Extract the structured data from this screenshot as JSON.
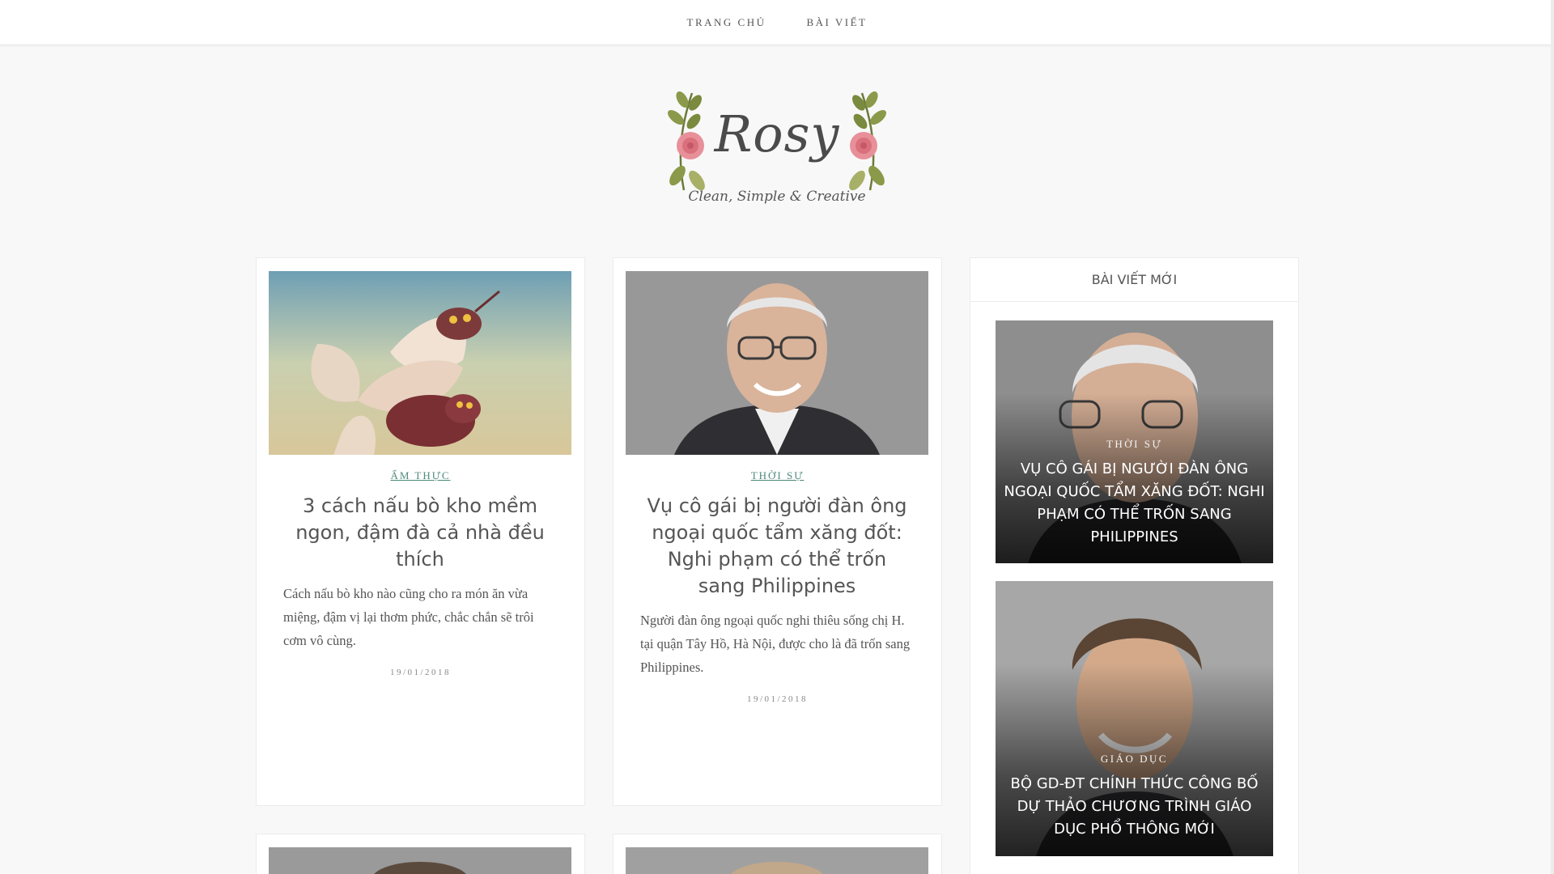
{
  "nav": {
    "items": [
      "TRANG CHỦ",
      "BÀI VIẾT"
    ]
  },
  "logo": {
    "title": "Rosy",
    "tagline": "Clean, Simple & Creative"
  },
  "posts": [
    {
      "category": "ẨM THỰC",
      "title": "3 cách nấu bò kho mềm ngon, đậm đà cả nhà đều thích",
      "excerpt": "Cách nấu bò kho nào cũng cho ra món ăn vừa miệng, đậm vị lại thơm phức, chắc chắn sẽ trôi cơm vô cùng.",
      "date": "19/01/2018",
      "image": "fantasy-bird-creature-illustration"
    },
    {
      "category": "THỜI SỰ",
      "title": "Vụ cô gái bị người đàn ông ngoại quốc tẩm xăng đốt: Nghi phạm có thể trốn sang Philippines",
      "excerpt": "Người đàn ông ngoại quốc nghi thiêu sống chị H. tại quận Tây Hồ, Hà Nội, được cho là đã trốn sang Philippines.",
      "date": "19/01/2018",
      "image": "elderly-man-portrait"
    }
  ],
  "sidebar": {
    "title": "BÀI VIẾT MỚI",
    "items": [
      {
        "category": "THỜI SỰ",
        "title": "VỤ CÔ GÁI BỊ NGƯỜI ĐÀN ÔNG NGOẠI QUỐC TẨM XĂNG ĐỐT: NGHI PHẠM CÓ THỂ TRỐN SANG PHILIPPINES",
        "image": "elderly-man-portrait"
      },
      {
        "category": "GIÁO DỤC",
        "title": "BỘ GD-ĐT CHÍNH THỨC CÔNG BỐ DỰ THẢO CHƯƠNG TRÌNH GIÁO DỤC PHỔ THÔNG MỚI",
        "image": "smiling-young-man-portrait"
      }
    ]
  },
  "colors": {
    "category": "#4d8a7a",
    "background": "#f8f8f8",
    "card": "#ffffff",
    "logo_pink": "#e8909a",
    "logo_leaf": "#8a9a4a"
  }
}
